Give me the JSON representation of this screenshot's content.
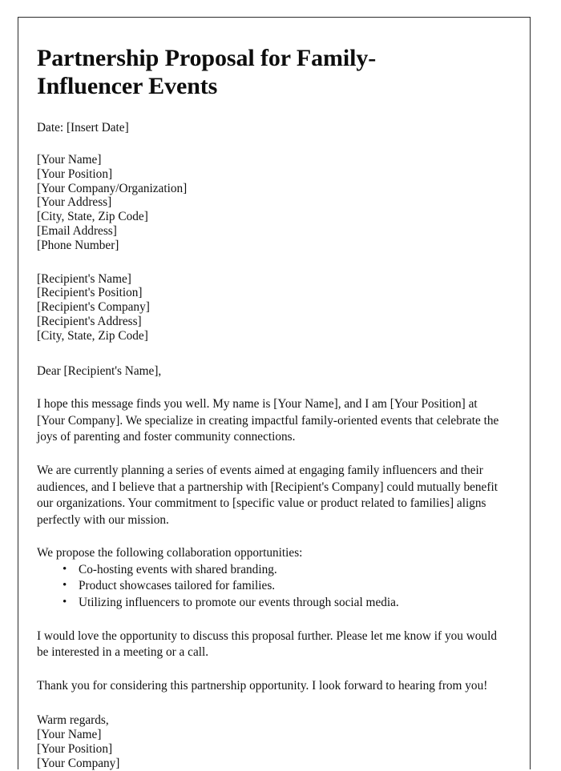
{
  "document": {
    "title": "Partnership Proposal for Family-Influencer Events",
    "date_line": "Date: [Insert Date]",
    "sender_block": [
      "[Your Name]",
      "[Your Position]",
      "[Your Company/Organization]",
      "[Your Address]",
      "[City, State, Zip Code]",
      "[Email Address]",
      "[Phone Number]"
    ],
    "recipient_block": [
      "[Recipient's Name]",
      "[Recipient's Position]",
      "[Recipient's Company]",
      "[Recipient's Address]",
      "[City, State, Zip Code]"
    ],
    "salutation": "Dear [Recipient's Name],",
    "paragraph_1": "I hope this message finds you well. My name is [Your Name], and I am [Your Position] at [Your Company]. We specialize in creating impactful family-oriented events that celebrate the joys of parenting and foster community connections.",
    "paragraph_2": "We are currently planning a series of events aimed at engaging family influencers and their audiences, and I believe that a partnership with [Recipient's Company] could mutually benefit our organizations. Your commitment to [specific value or product related to families] aligns perfectly with our mission.",
    "list_intro": "We propose the following collaboration opportunities:",
    "bullets": [
      "Co-hosting events with shared branding.",
      "Product showcases tailored for families.",
      "Utilizing influencers to promote our events through social media."
    ],
    "paragraph_3": "I would love the opportunity to discuss this proposal further. Please let me know if you would be interested in a meeting or a call.",
    "paragraph_4": "Thank you for considering this partnership opportunity. I look forward to hearing from you!",
    "closing": "Warm regards,",
    "signature_block": [
      "[Your Name]",
      "[Your Position]",
      "[Your Company]"
    ]
  },
  "colors": {
    "page_background": "#ffffff",
    "page_border": "#2b2b2b",
    "text": "#111111",
    "title_text": "#0d0d0d"
  }
}
